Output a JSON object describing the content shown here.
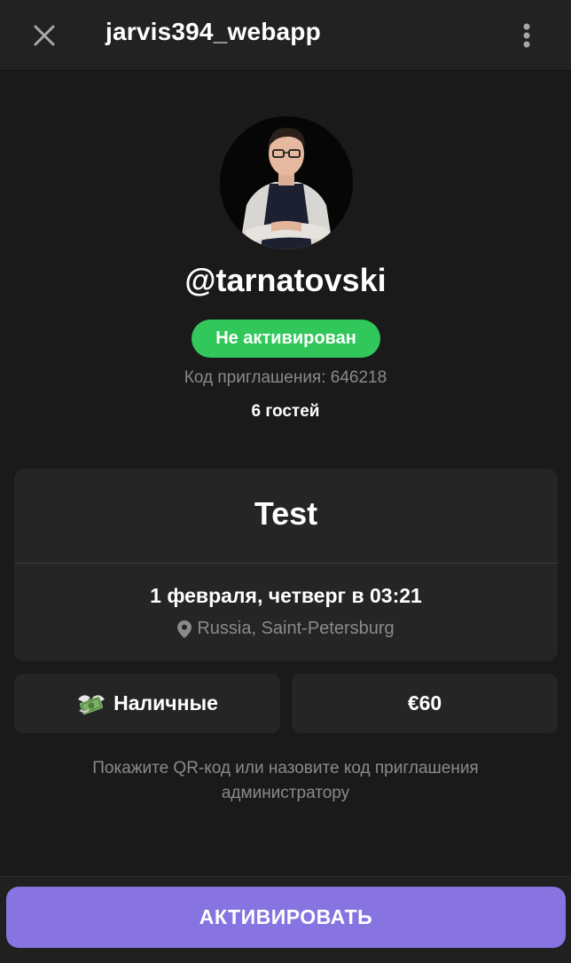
{
  "header": {
    "title": "jarvis394_webapp",
    "close_icon": "close-icon",
    "menu_icon": "more-vertical-icon"
  },
  "profile": {
    "username": "@tarnatovski",
    "status": "Не активирован",
    "invite_code": "Код приглашения: 646218",
    "guests": "6 гостей"
  },
  "event": {
    "title": "Test",
    "date": "1 февраля, четверг в 03:21",
    "location": "Russia, Saint-Petersburg"
  },
  "payment": {
    "method": "Наличные",
    "method_icon": "money-with-wings-icon",
    "price": "€60"
  },
  "hint": "Покажите QR-код или назовите код приглашения администратору",
  "action": {
    "activate_label": "АКТИВИРОВАТЬ"
  },
  "colors": {
    "background": "#1a1a1a",
    "card": "#252525",
    "status_green": "#31c75a",
    "accent_purple": "#8774e1",
    "muted_text": "#8a8a8a"
  }
}
